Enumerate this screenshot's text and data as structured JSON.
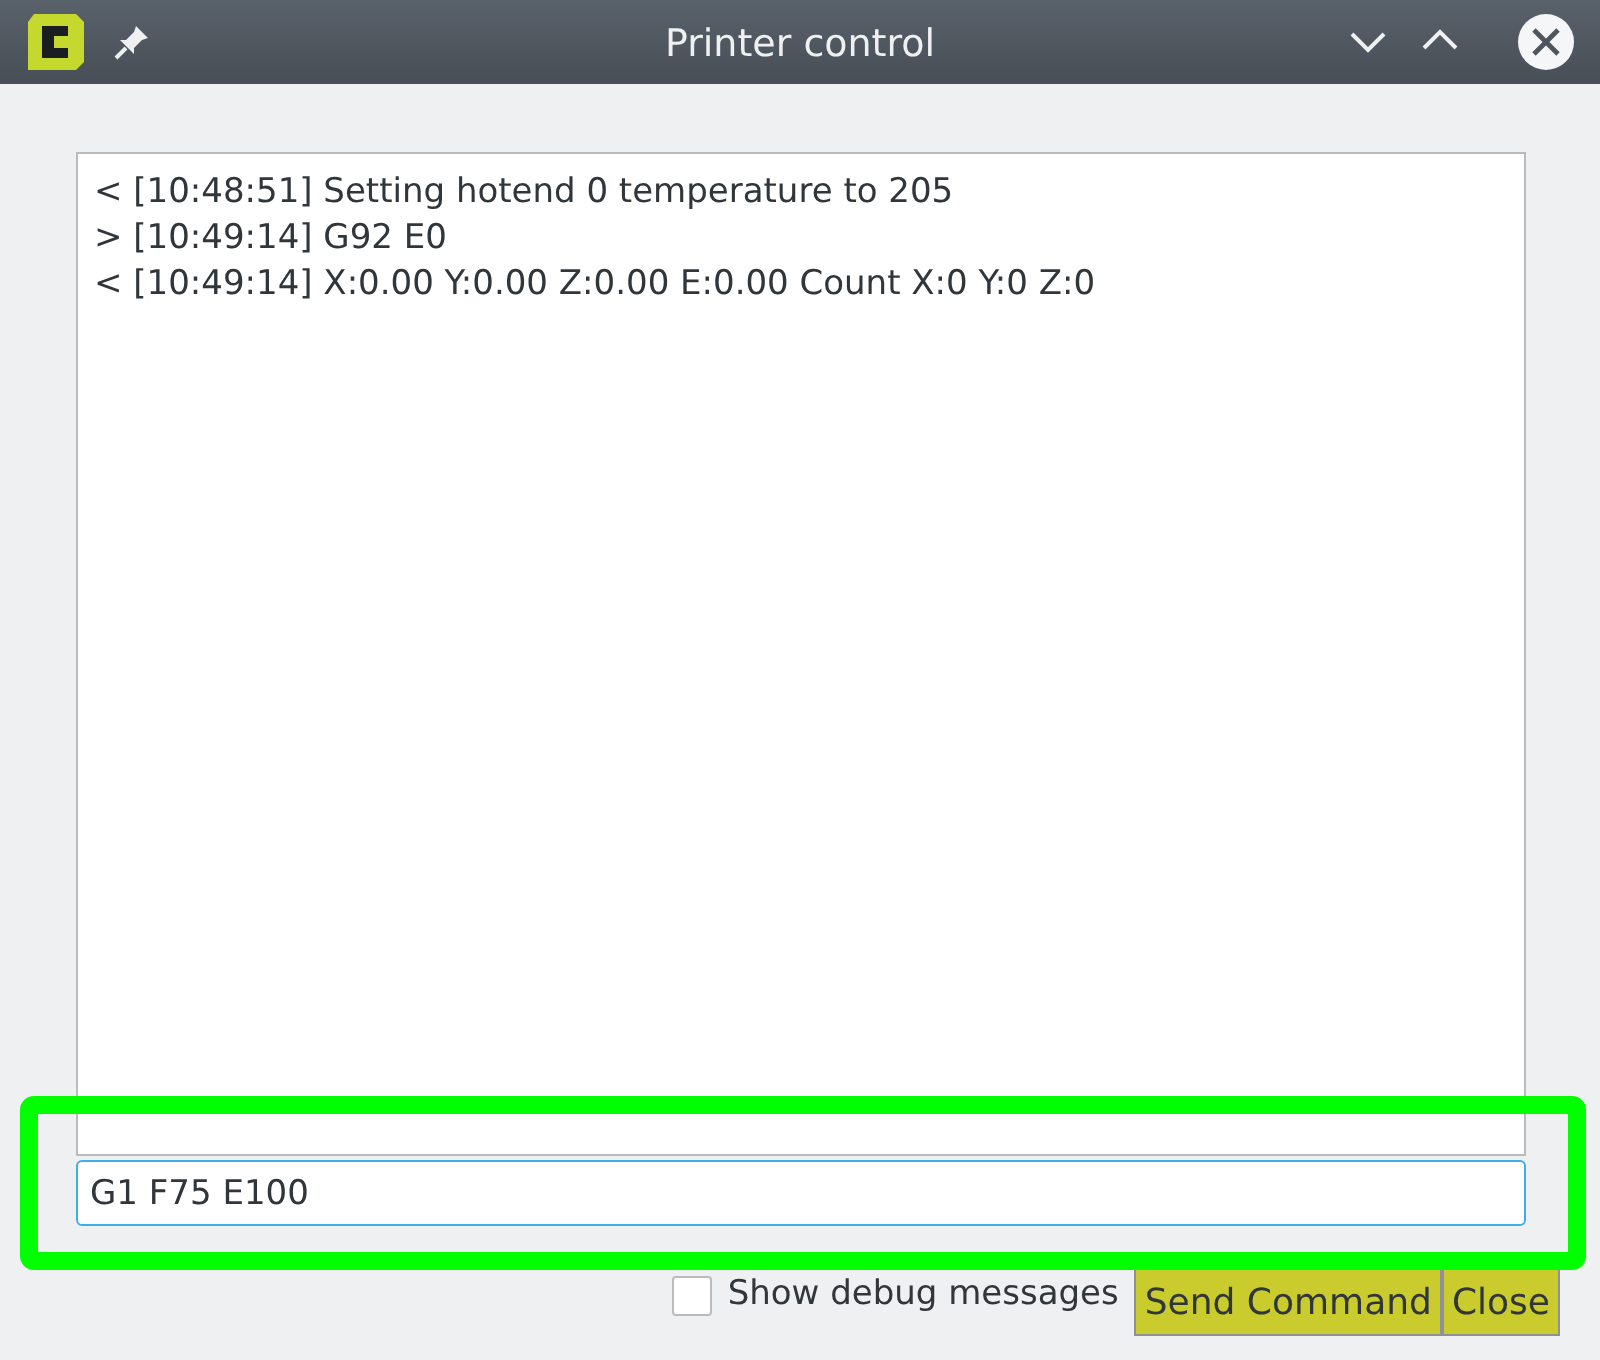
{
  "window": {
    "title": "Printer control"
  },
  "log": {
    "lines": [
      "< [10:48:51] Setting hotend 0 temperature to 205",
      "> [10:49:14] G92 E0",
      "< [10:49:14] X:0.00 Y:0.00 Z:0.00 E:0.00 Count X:0 Y:0 Z:0"
    ]
  },
  "command_input": {
    "value": "G1 F75 E100"
  },
  "debug_checkbox": {
    "label": "Show debug messages",
    "checked": false
  },
  "buttons": [
    {
      "label": "Send Command"
    },
    {
      "label": "Close"
    }
  ]
}
